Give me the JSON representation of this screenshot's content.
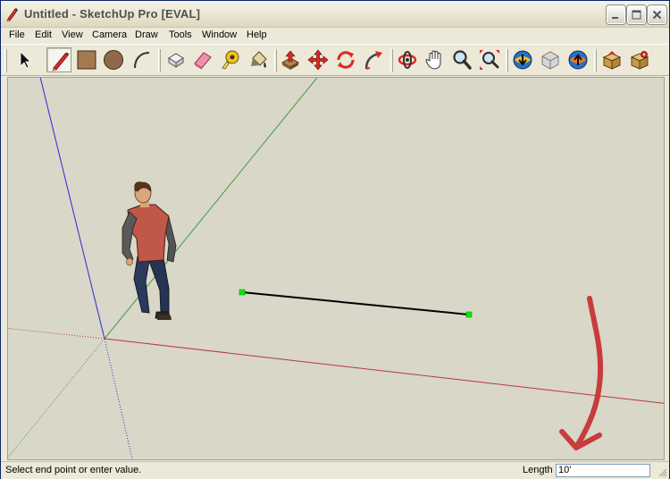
{
  "window": {
    "title": "Untitled - SketchUp Pro [EVAL]"
  },
  "menu": [
    "File",
    "Edit",
    "View",
    "Camera",
    "Draw",
    "Tools",
    "Window",
    "Help"
  ],
  "toolbar": {
    "tools": [
      {
        "name": "select-tool",
        "icon": "arrow-cursor-icon"
      },
      {
        "name": "line-tool",
        "icon": "pencil-icon",
        "active": true
      },
      {
        "name": "rectangle-tool",
        "icon": "rectangle-icon"
      },
      {
        "name": "circle-tool",
        "icon": "circle-icon"
      },
      {
        "name": "arc-tool",
        "icon": "arc-icon"
      },
      {
        "name": "make-component-tool",
        "icon": "component-icon"
      },
      {
        "name": "eraser-tool",
        "icon": "eraser-icon"
      },
      {
        "name": "tape-measure-tool",
        "icon": "tape-measure-icon"
      },
      {
        "name": "paint-bucket-tool",
        "icon": "paint-bucket-icon"
      },
      {
        "name": "push-pull-tool",
        "icon": "push-pull-icon"
      },
      {
        "name": "move-tool",
        "icon": "move-icon"
      },
      {
        "name": "rotate-tool",
        "icon": "rotate-icon"
      },
      {
        "name": "follow-me-tool",
        "icon": "follow-me-icon"
      },
      {
        "name": "orbit-tool",
        "icon": "orbit-icon"
      },
      {
        "name": "pan-tool",
        "icon": "hand-icon"
      },
      {
        "name": "zoom-tool",
        "icon": "zoom-icon"
      },
      {
        "name": "zoom-extents-tool",
        "icon": "zoom-extents-icon"
      },
      {
        "name": "get-models-tool",
        "icon": "globe-download-icon"
      },
      {
        "name": "share-component-tool",
        "icon": "share-component-icon"
      },
      {
        "name": "share-model-tool",
        "icon": "globe-share-icon"
      },
      {
        "name": "extension-warehouse-tool",
        "icon": "box-icon"
      },
      {
        "name": "extension-manager-tool",
        "icon": "box-gear-icon"
      }
    ]
  },
  "status": {
    "prompt": "Select end point or enter value.",
    "vcb_label": "Length",
    "vcb_value": "10'"
  },
  "colors": {
    "viewport_bg": "#d9d7c7",
    "red_axis": "#b33a3a",
    "green_axis": "#3f9a3f",
    "blue_axis": "#2a2ad0",
    "endpoint": "#00ee00",
    "annotation_arrow": "#c83c3c"
  }
}
